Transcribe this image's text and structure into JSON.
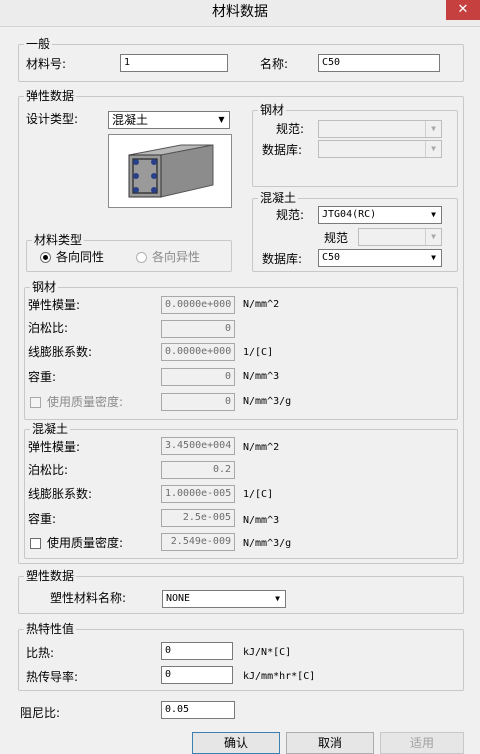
{
  "window": {
    "title": "材料数据",
    "close_glyph": "✕"
  },
  "general": {
    "legend": "一般",
    "material_no_label": "材料号:",
    "material_no_value": "1",
    "name_label": "名称:",
    "name_value": "C50"
  },
  "elastic": {
    "legend": "弹性数据",
    "design_type_label": "设计类型:",
    "design_type_value": "混凝土",
    "material_type": {
      "legend": "材料类型",
      "isotropic_label": "各向同性",
      "anisotropic_label": "各向异性",
      "selected": "isotropic"
    }
  },
  "steel_panel": {
    "legend": "钢材",
    "standard_label": "规范:",
    "standard_value": "",
    "database_label": "数据库:",
    "database_value": ""
  },
  "concrete_panel": {
    "legend": "混凝土",
    "standard_label": "规范:",
    "standard_value": "JTG04(RC)",
    "substandard_label": "规范",
    "substandard_value": "",
    "database_label": "数据库:",
    "database_value": "C50"
  },
  "steel_props": {
    "legend": "钢材",
    "elastic_modulus_label": "弹性模量:",
    "elastic_modulus_value": "0.0000e+000",
    "elastic_modulus_unit": "N/mm^2",
    "poisson_label": "泊松比:",
    "poisson_value": "0",
    "thermal_label": "线膨胀系数:",
    "thermal_value": "0.0000e+000",
    "thermal_unit": "1/[C]",
    "weight_label": "容重:",
    "weight_value": "0",
    "weight_unit": "N/mm^3",
    "mass_density_label": "使用质量密度:",
    "mass_density_value": "0",
    "mass_density_unit": "N/mm^3/g"
  },
  "concrete_props": {
    "legend": "混凝土",
    "elastic_modulus_label": "弹性模量:",
    "elastic_modulus_value": "3.4500e+004",
    "elastic_modulus_unit": "N/mm^2",
    "poisson_label": "泊松比:",
    "poisson_value": "0.2",
    "thermal_label": "线膨胀系数:",
    "thermal_value": "1.0000e-005",
    "thermal_unit": "1/[C]",
    "weight_label": "容重:",
    "weight_value": "2.5e-005",
    "weight_unit": "N/mm^3",
    "mass_density_label": "使用质量密度:",
    "mass_density_value": "2.549e-009",
    "mass_density_unit": "N/mm^3/g"
  },
  "plastic": {
    "legend": "塑性数据",
    "name_label": "塑性材料名称:",
    "name_value": "NONE"
  },
  "thermal": {
    "legend": "热特性值",
    "specific_heat_label": "比热:",
    "specific_heat_value": "0",
    "specific_heat_unit": "kJ/N*[C]",
    "conductivity_label": "热传导率:",
    "conductivity_value": "0",
    "conductivity_unit": "kJ/mm*hr*[C]"
  },
  "damping": {
    "label": "阻尼比:",
    "value": "0.05"
  },
  "buttons": {
    "ok": "确认",
    "cancel": "取消",
    "apply": "适用"
  },
  "icons": {
    "dropdown": "▼",
    "close": "close-icon",
    "preview": "concrete-beam-icon"
  },
  "colors": {
    "title_bar": "#ececec",
    "close_button": "#c74040",
    "window_bg": "#f0f0f0",
    "focus_border": "#3c7fb1"
  }
}
